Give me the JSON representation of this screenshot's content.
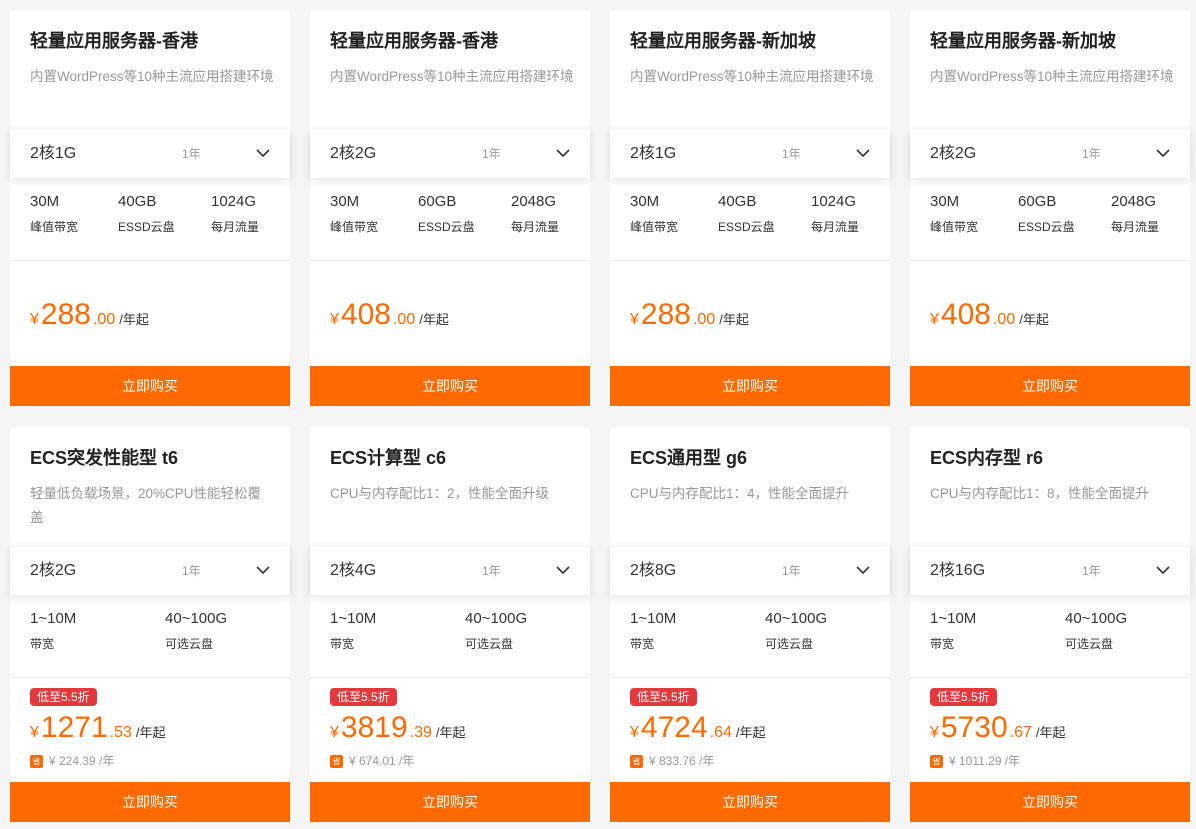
{
  "buy_label": "立即购买",
  "currency": "¥",
  "accent_color": "#ff6a00",
  "badge_color": "#e4393c",
  "cards": [
    {
      "title": "轻量应用服务器-香港",
      "desc": "内置WordPress等10种主流应用搭建环境",
      "spec": "2核1G",
      "period": "1年",
      "specs": [
        {
          "value": "30M",
          "label": "峰值带宽"
        },
        {
          "value": "40GB",
          "label": "ESSD云盘"
        },
        {
          "value": "1024G",
          "label": "每月流量"
        }
      ],
      "price_int": "288",
      "price_dec": ".00",
      "price_unit": "/年起"
    },
    {
      "title": "轻量应用服务器-香港",
      "desc": "内置WordPress等10种主流应用搭建环境",
      "spec": "2核2G",
      "period": "1年",
      "specs": [
        {
          "value": "30M",
          "label": "峰值带宽"
        },
        {
          "value": "60GB",
          "label": "ESSD云盘"
        },
        {
          "value": "2048G",
          "label": "每月流量"
        }
      ],
      "price_int": "408",
      "price_dec": ".00",
      "price_unit": "/年起"
    },
    {
      "title": "轻量应用服务器-新加坡",
      "desc": "内置WordPress等10种主流应用搭建环境",
      "spec": "2核1G",
      "period": "1年",
      "specs": [
        {
          "value": "30M",
          "label": "峰值带宽"
        },
        {
          "value": "40GB",
          "label": "ESSD云盘"
        },
        {
          "value": "1024G",
          "label": "每月流量"
        }
      ],
      "price_int": "288",
      "price_dec": ".00",
      "price_unit": "/年起"
    },
    {
      "title": "轻量应用服务器-新加坡",
      "desc": "内置WordPress等10种主流应用搭建环境",
      "spec": "2核2G",
      "period": "1年",
      "specs": [
        {
          "value": "30M",
          "label": "峰值带宽"
        },
        {
          "value": "60GB",
          "label": "ESSD云盘"
        },
        {
          "value": "2048G",
          "label": "每月流量"
        }
      ],
      "price_int": "408",
      "price_dec": ".00",
      "price_unit": "/年起"
    },
    {
      "title": "ECS突发性能型 t6",
      "desc": "轻量低负载场景，20%CPU性能轻松覆盖",
      "spec": "2核2G",
      "period": "1年",
      "specs": [
        {
          "value": "1~10M",
          "label": "带宽"
        },
        {
          "value": "40~100G",
          "label": "可选云盘"
        }
      ],
      "badge": "低至5.5折",
      "price_int": "1271",
      "price_dec": ".53",
      "price_unit": "/年起",
      "save_icon": "省",
      "save_text": "¥ 224.39 /年"
    },
    {
      "title": "ECS计算型 c6",
      "desc": "CPU与内存配比1：2，性能全面升级",
      "spec": "2核4G",
      "period": "1年",
      "specs": [
        {
          "value": "1~10M",
          "label": "带宽"
        },
        {
          "value": "40~100G",
          "label": "可选云盘"
        }
      ],
      "badge": "低至5.5折",
      "price_int": "3819",
      "price_dec": ".39",
      "price_unit": "/年起",
      "save_icon": "省",
      "save_text": "¥ 674.01 /年"
    },
    {
      "title": "ECS通用型 g6",
      "desc": "CPU与内存配比1：4，性能全面提升",
      "spec": "2核8G",
      "period": "1年",
      "specs": [
        {
          "value": "1~10M",
          "label": "带宽"
        },
        {
          "value": "40~100G",
          "label": "可选云盘"
        }
      ],
      "badge": "低至5.5折",
      "price_int": "4724",
      "price_dec": ".64",
      "price_unit": "/年起",
      "save_icon": "省",
      "save_text": "¥ 833.76 /年"
    },
    {
      "title": "ECS内存型 r6",
      "desc": "CPU与内存配比1：8，性能全面提升",
      "spec": "2核16G",
      "period": "1年",
      "specs": [
        {
          "value": "1~10M",
          "label": "带宽"
        },
        {
          "value": "40~100G",
          "label": "可选云盘"
        }
      ],
      "badge": "低至5.5折",
      "price_int": "5730",
      "price_dec": ".67",
      "price_unit": "/年起",
      "save_icon": "省",
      "save_text": "¥ 1011.29 /年"
    }
  ]
}
